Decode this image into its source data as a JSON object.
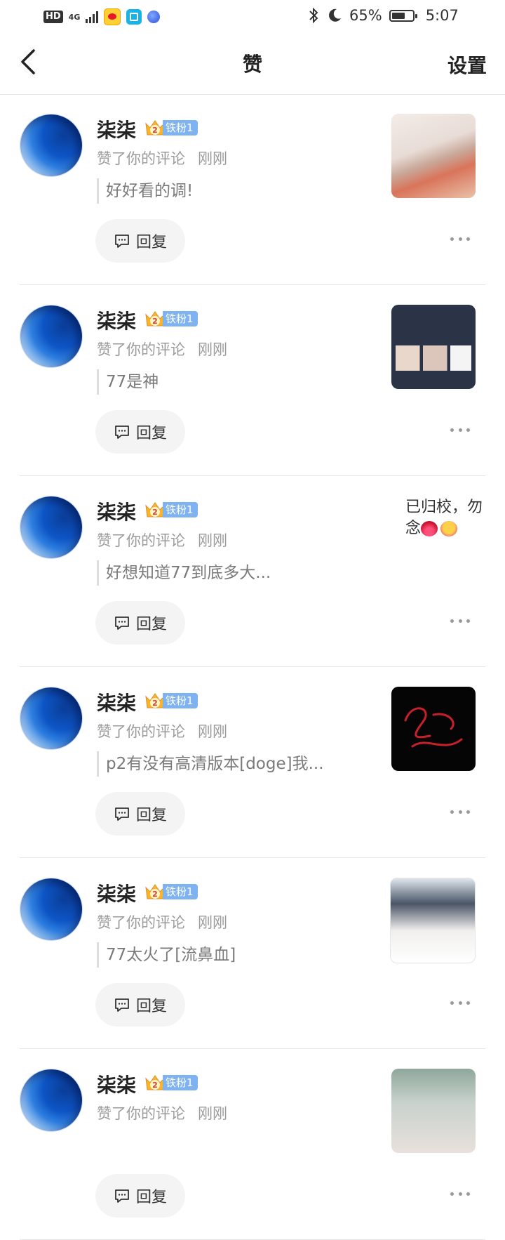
{
  "status_bar": {
    "network_type": "4G",
    "hd_label": "HD",
    "battery_percent": "65%",
    "battery_level": 0.65,
    "time": "5:07",
    "icons": [
      "bluetooth-icon",
      "do-not-disturb-moon-icon"
    ]
  },
  "header": {
    "title": "赞",
    "settings_label": "设置",
    "back_icon": "back-chevron-icon"
  },
  "colors": {
    "fan_badge": "#7eb2f0",
    "reply_pill": "#f4f4f4",
    "secondary_text": "#9a9a9a"
  },
  "items": [
    {
      "name": "柒柒",
      "badge_level": "2",
      "fan_badge": "铁粉1",
      "action": "赞了你的评论",
      "time": "刚刚",
      "comment": "好好看的调!",
      "reply_label": "回复",
      "preview": "image"
    },
    {
      "name": "柒柒",
      "badge_level": "2",
      "fan_badge": "铁粉1",
      "action": "赞了你的评论",
      "time": "刚刚",
      "comment": "77是神",
      "reply_label": "回复",
      "preview": "image"
    },
    {
      "name": "柒柒",
      "badge_level": "2",
      "fan_badge": "铁粉1",
      "action": "赞了你的评论",
      "time": "刚刚",
      "comment": "好想知道77到底多大...",
      "reply_label": "回复",
      "preview": "text",
      "preview_text": "已归校，勿念"
    },
    {
      "name": "柒柒",
      "badge_level": "2",
      "fan_badge": "铁粉1",
      "action": "赞了你的评论",
      "time": "刚刚",
      "comment": "p2有没有高清版本[doge]我...",
      "reply_label": "回复",
      "preview": "image"
    },
    {
      "name": "柒柒",
      "badge_level": "2",
      "fan_badge": "铁粉1",
      "action": "赞了你的评论",
      "time": "刚刚",
      "comment": "77太火了[流鼻血]",
      "reply_label": "回复",
      "preview": "image"
    },
    {
      "name": "柒柒",
      "badge_level": "2",
      "fan_badge": "铁粉1",
      "action": "赞了你的评论",
      "time": "刚刚",
      "comment": "",
      "reply_label": "回复",
      "preview": "image"
    }
  ]
}
